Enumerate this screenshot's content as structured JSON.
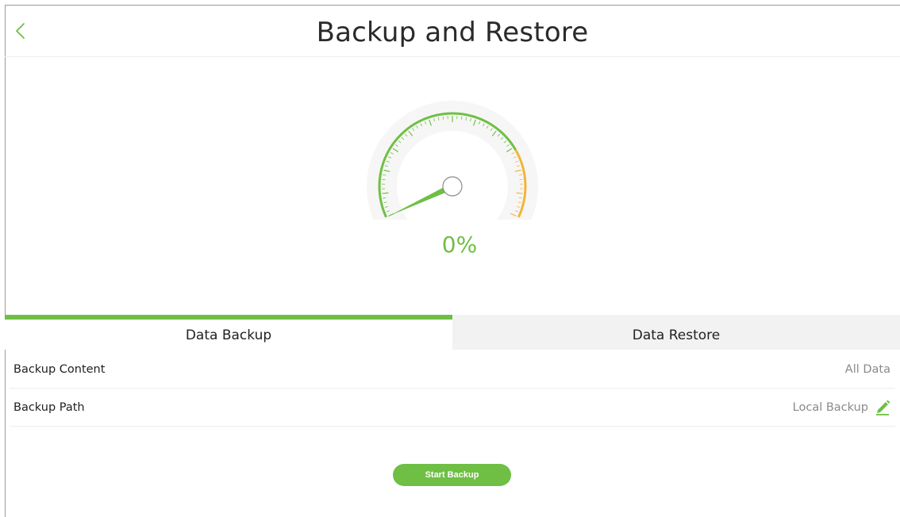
{
  "header": {
    "title": "Backup and Restore",
    "back_icon": "chevron-left-icon"
  },
  "gauge": {
    "percent_label": "0%",
    "progress_percent": 0,
    "accent_color": "#6fbf45",
    "high_color": "#f2b43c"
  },
  "tabs": [
    {
      "label": "Data Backup",
      "active": true
    },
    {
      "label": "Data Restore",
      "active": false
    }
  ],
  "settings": {
    "backup_content": {
      "label": "Backup Content",
      "value": "All Data"
    },
    "backup_path": {
      "label": "Backup Path",
      "value": "Local Backup",
      "icon": "pencil-icon"
    }
  },
  "actions": {
    "start_backup_label": "Start Backup"
  },
  "colors": {
    "accent": "#6fbf45",
    "muted_text": "#8a8a8a",
    "inactive_tab_bg": "#f2f2f2"
  }
}
